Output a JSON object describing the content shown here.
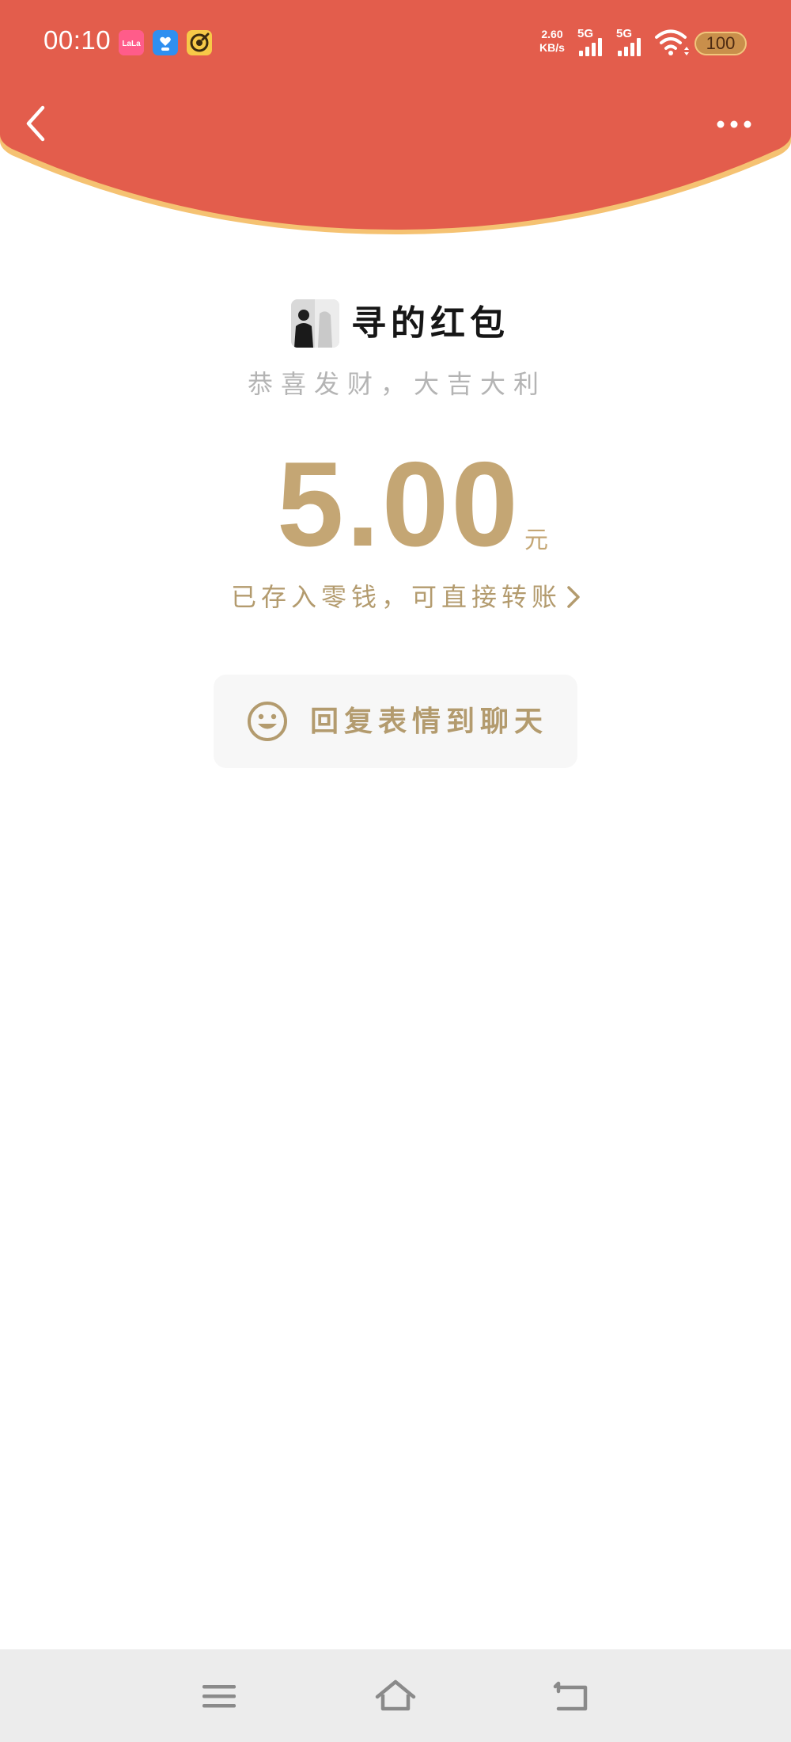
{
  "status_bar": {
    "time": "00:10",
    "network_speed_value": "2.60",
    "network_speed_unit": "KB/s",
    "signal_1_label": "5G",
    "signal_2_label": "5G",
    "battery_level": "100",
    "notification_icons": [
      "lala-app-icon",
      "blue-heart-app-icon",
      "yellow-target-app-icon"
    ]
  },
  "navigation": {
    "back_icon": "chevron-left-icon",
    "more_icon": "more-dots-icon"
  },
  "envelope": {
    "sender_title": "寻的红包",
    "blessing": "恭喜发财，大吉大利",
    "amount": "5.00",
    "currency": "元",
    "stored_message": "已存入零钱，可直接转账",
    "reply_button_label": "回复表情到聊天",
    "reply_icon": "smile-icon"
  },
  "bottom_nav": {
    "items": [
      "menu-icon",
      "home-icon",
      "back-icon"
    ]
  },
  "colors": {
    "header_red": "#e35d4c",
    "header_rim": "#f5c272",
    "gold_text": "#c4a674",
    "gold_text_dark": "#b39b6e",
    "blessing_gray": "#b4b4b4",
    "button_bg": "#f7f7f7",
    "nav_bar_bg": "#ececec"
  }
}
